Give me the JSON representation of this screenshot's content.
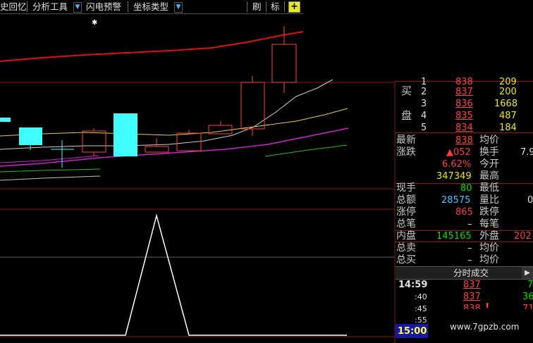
{
  "toolbar": {
    "item1": "史回忆",
    "item2": "分析工具",
    "item3": "闪电预警",
    "item4": "坐标类型",
    "item5": "刷",
    "item6": "标",
    "plus": "+"
  },
  "colors": {
    "background": "#000000",
    "up": "#ff4040",
    "down": "#00ffff",
    "ma_red": "#e01010",
    "ma_white": "#d0d0d0",
    "ma_yellow": "#e0d040",
    "ma_magenta": "#d020d0",
    "ma_green": "#20c020",
    "border": "#8b1a1a"
  },
  "order_book": {
    "buy_label_1": "买",
    "buy_label_2": "盘",
    "rows": [
      {
        "level": "1",
        "price": "838",
        "volume": "209"
      },
      {
        "level": "2",
        "price": "837",
        "volume": "200"
      },
      {
        "level": "3",
        "price": "836",
        "volume": "1668"
      },
      {
        "level": "4",
        "price": "835",
        "volume": "487"
      },
      {
        "level": "5",
        "price": "834",
        "volume": "184"
      }
    ]
  },
  "quote": {
    "latest_label": "最新",
    "latest_value": "838",
    "avg_label": "均价",
    "change_label": "涨跌",
    "change_value": "▲052",
    "turnover_label": "换手",
    "turnover_value": "7.9",
    "pct_value": "6.62%",
    "open_label": "今开",
    "volume_value": "347349",
    "high_label": "最高",
    "current_hand_label": "现手",
    "current_hand_value": "80",
    "low_label": "最低",
    "amount_label": "总额",
    "amount_value": "28575",
    "ratio_label": "量比",
    "ratio_value": "0",
    "limit_up_label": "涨停",
    "limit_up_value": "865",
    "limit_down_label": "跌停",
    "total_trades_label": "总笔",
    "total_trades_value": "–",
    "per_trade_label": "每笔",
    "inner_label": "内盘",
    "inner_value": "145165",
    "outer_label": "外盘",
    "outer_value": "202",
    "total_sell_label": "总卖",
    "total_sell_value": "–",
    "avg_price_label_1": "均价",
    "total_buy_label": "总买",
    "total_buy_value": "–",
    "avg_price_label_2": "均价"
  },
  "ticks_tab": {
    "label": "分时成交",
    "arrow": "▶"
  },
  "ticks": [
    {
      "time": "14:59",
      "price": "837",
      "vol": "7"
    },
    {
      "time": ":40",
      "price": "837",
      "vol": "36"
    },
    {
      "time": ":45",
      "price": "838",
      "vol": "71"
    },
    {
      "time": ":55",
      "price": "",
      "vol": ""
    },
    {
      "time": "15:00",
      "price": "",
      "vol": ""
    }
  ],
  "watermark": "www.7gpzb.com"
}
